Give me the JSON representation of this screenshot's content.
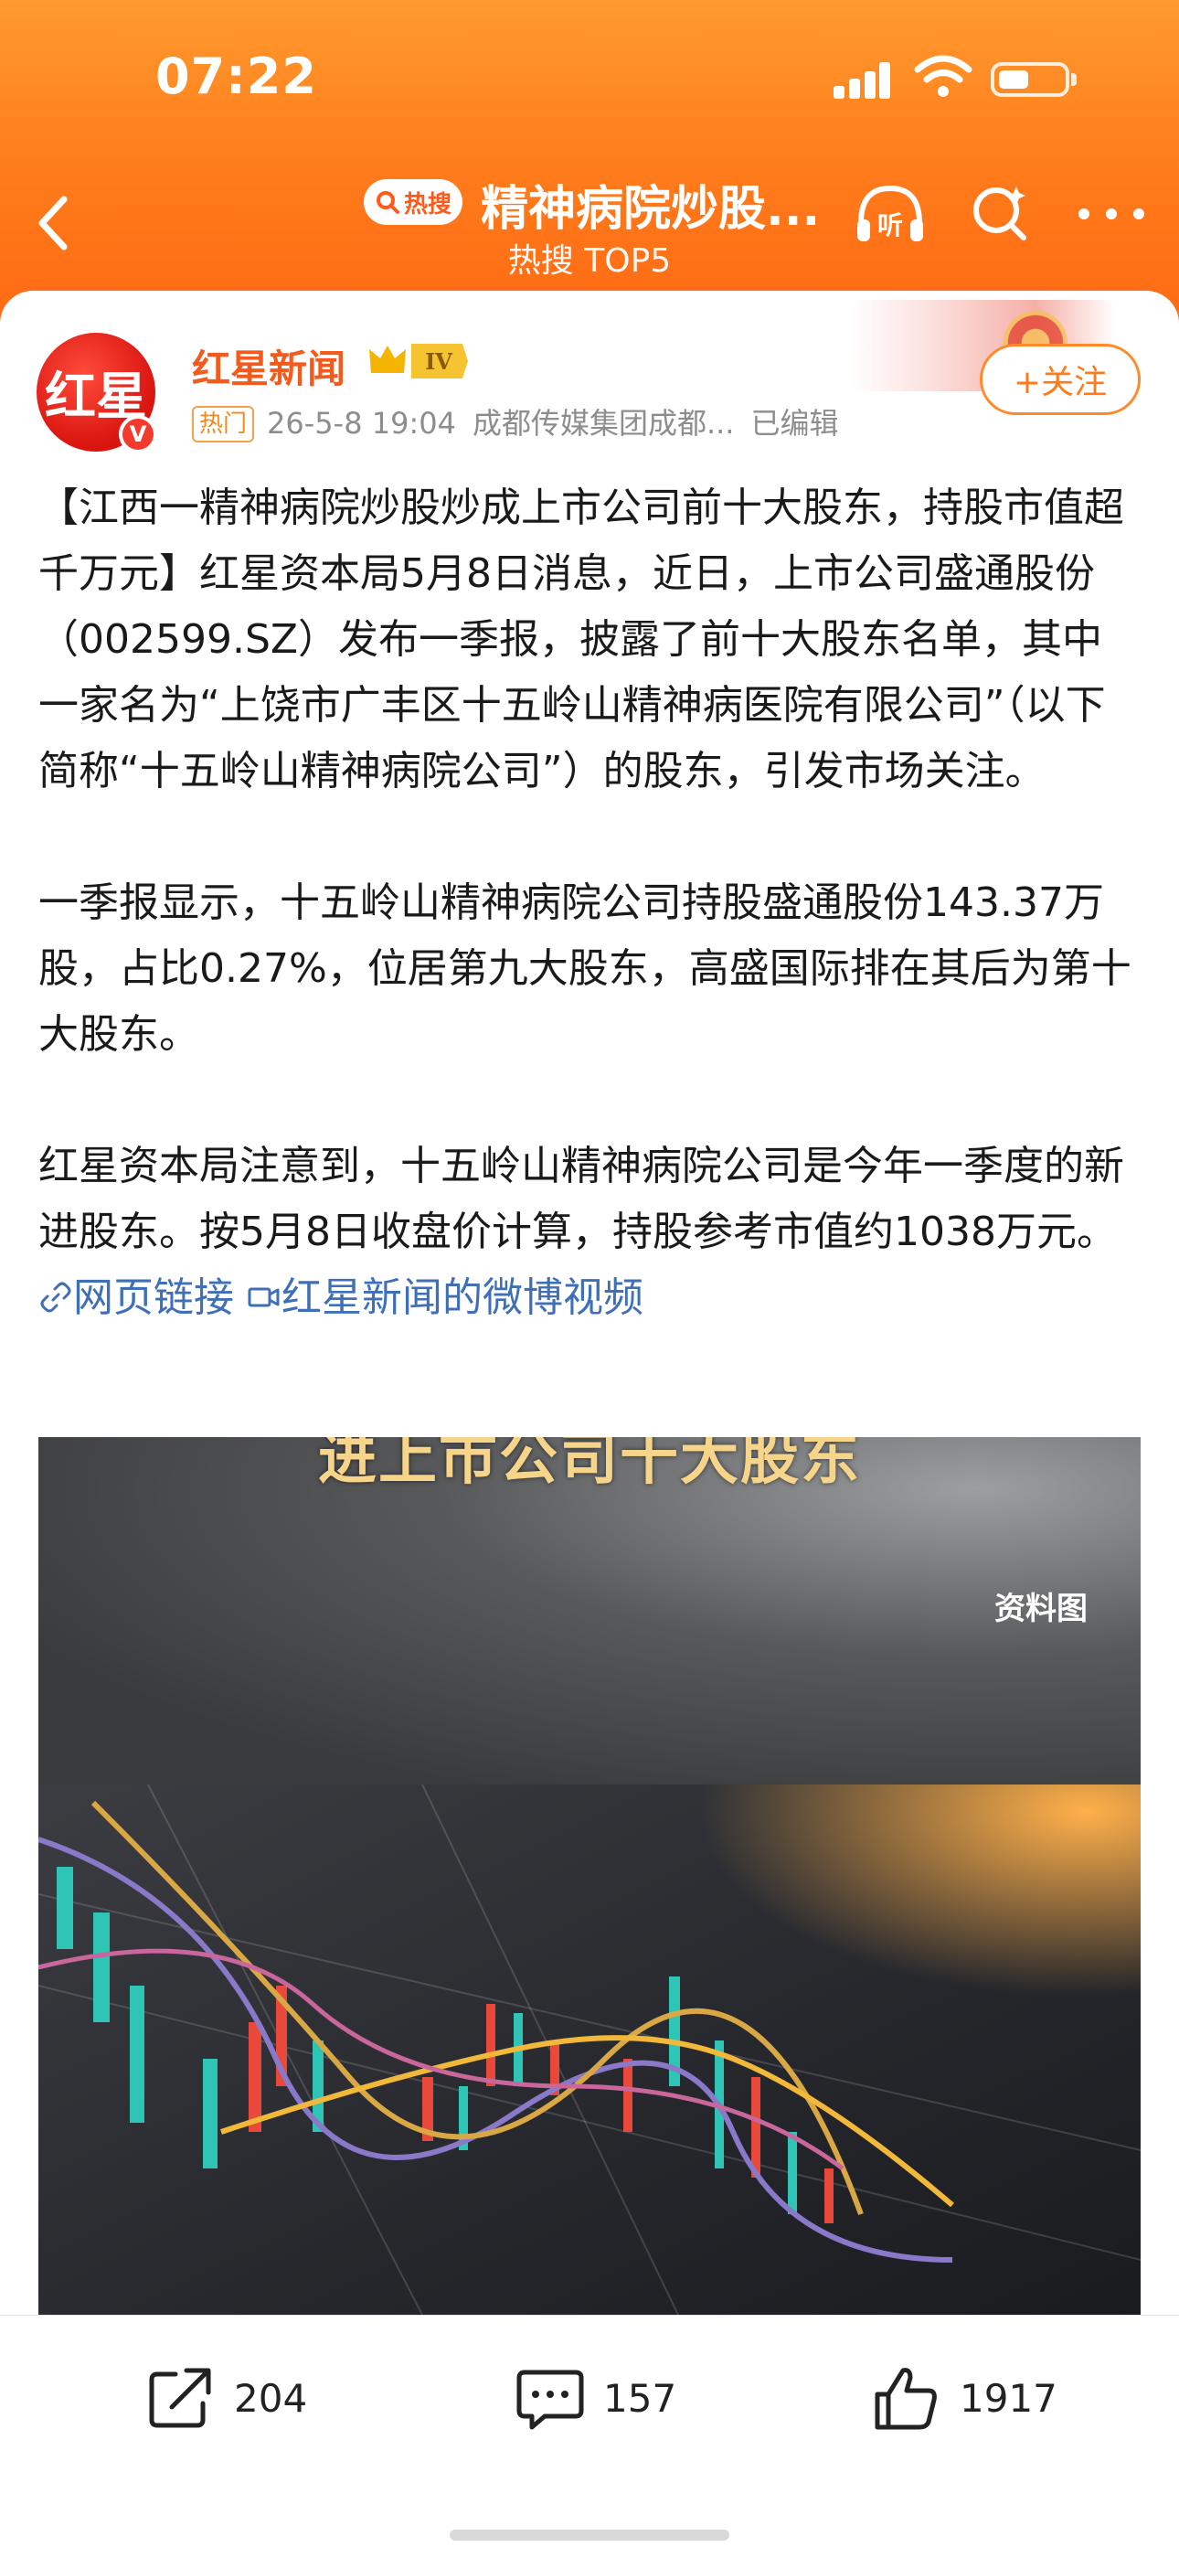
{
  "status_bar": {
    "time": "07:22"
  },
  "nav": {
    "hot_badge": "热搜",
    "title": "精神病院炒股...",
    "subtitle": "热搜 TOP5"
  },
  "post": {
    "author": "红星新闻",
    "level_badge": "IV",
    "avatar_text": "红星",
    "hot_tag": "热门",
    "time": "26-5-8 19:04",
    "source": "成都传媒集团成都...",
    "edited": "已编辑",
    "follow_label": "+关注",
    "para1": "【江西一精神病院炒股炒成上市公司前十大股东，持股市值超千万元】红星资本局5月8日消息，近日，上市公司盛通股份（002599.SZ）发布一季报，披露了前十大股东名单，其中一家名为“上饶市广丰区十五岭山精神病医院有限公司”（以下简称“十五岭山精神病院公司”）的股东，引发市场关注。",
    "para2": "一季报显示，十五岭山精神病院公司持股盛通股份143.37万股，占比0.27%，位居第九大股东，高盛国际排在其后为第十大股东。",
    "para3": "红星资本局注意到，十五岭山精神病院公司是今年一季度的新进股东。按5月8日收盘价计算，持股参考市值约1038万元。",
    "link_web": "网页链接",
    "link_video": "红星新闻的微博视频",
    "image_caption": "进上市公司十大股东",
    "image_tag": "资料图"
  },
  "actions": {
    "share_count": "204",
    "comment_count": "157",
    "like_count": "1917"
  },
  "colors": {
    "header_orange": "#ff7a1a",
    "author_orange": "#f25a1e",
    "link_blue": "#3f6fb6"
  }
}
